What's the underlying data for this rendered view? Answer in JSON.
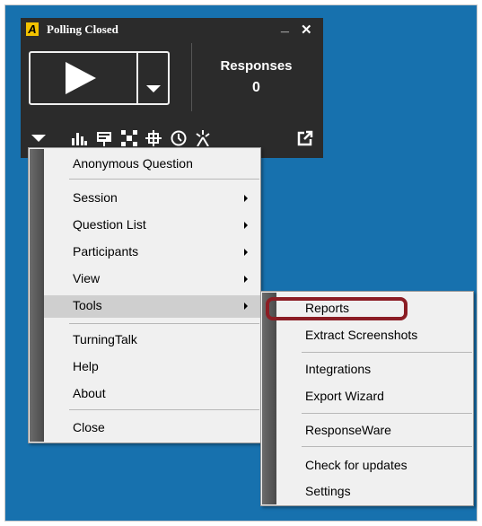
{
  "polling": {
    "title": "Polling Closed",
    "minimize": "_",
    "close": "✕",
    "responses_label": "Responses",
    "responses_count": "0",
    "toolbar_icons": [
      "chevron-down-icon",
      "bar-chart-icon",
      "presentation-icon",
      "grid-icon",
      "crosshair-icon",
      "clock-icon",
      "wand-icon",
      "popout-icon"
    ]
  },
  "menu": {
    "items": [
      {
        "label": "Anonymous Question"
      },
      {
        "label": "Session"
      },
      {
        "label": "Question List"
      },
      {
        "label": "Participants"
      },
      {
        "label": "View"
      },
      {
        "label": "Tools"
      },
      {
        "label": "TurningTalk"
      },
      {
        "label": "Help"
      },
      {
        "label": "About"
      },
      {
        "label": "Close"
      }
    ]
  },
  "submenu": {
    "items": [
      {
        "label": "Reports"
      },
      {
        "label": "Extract Screenshots"
      },
      {
        "label": "Integrations"
      },
      {
        "label": "Export Wizard"
      },
      {
        "label": "ResponseWare"
      },
      {
        "label": "Check for updates"
      },
      {
        "label": "Settings"
      }
    ]
  },
  "colors": {
    "desktop": "#1771ae",
    "panel": "#2b2b2b",
    "highlight_ring": "#8b1d24"
  }
}
